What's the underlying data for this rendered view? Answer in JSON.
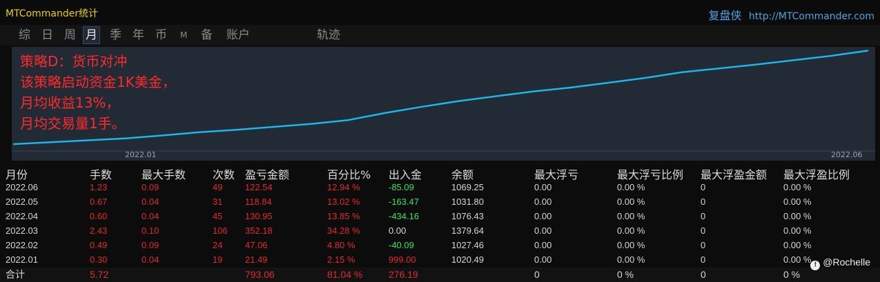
{
  "app_title": "MTCommander统计",
  "brand": {
    "name": "复盘侠",
    "url": "http://MTCommander.com"
  },
  "tabs": [
    {
      "label": "综"
    },
    {
      "label": "日"
    },
    {
      "label": "周"
    },
    {
      "label": "月",
      "active": true
    },
    {
      "label": "季"
    },
    {
      "label": "年"
    },
    {
      "label": "币"
    },
    {
      "label": "M"
    },
    {
      "label": "备"
    },
    {
      "label": "账户"
    },
    {
      "label": "轨迹"
    }
  ],
  "overlay": {
    "line1": "策略D：货币对冲",
    "line2": "该策略启动资金1K美金，",
    "line3": "月均收益13%，",
    "line4": "月均交易量1手。"
  },
  "colors": {
    "line": "#1eb4ec",
    "overlay_text": "#ff2a2a",
    "negative": "#e22a2a",
    "positive": "#2ee65a",
    "title": "#e8d100",
    "brand": "#4aa4e6"
  },
  "chart_data": {
    "type": "line",
    "x_ticks": [
      "2022.01",
      "2022.06"
    ],
    "series": [
      {
        "values": [
          1000,
          1004,
          1008,
          1012,
          1018,
          1025,
          1030,
          1036,
          1042,
          1050,
          1065,
          1078,
          1090,
          1100,
          1110,
          1118,
          1128,
          1138,
          1150,
          1158,
          1166,
          1175,
          1184,
          1195
        ]
      }
    ],
    "ylim": [
      990,
      1200
    ]
  },
  "table": {
    "headers": [
      "月份",
      "手数",
      "最大手数",
      "次数",
      "盈亏金额",
      "百分比%",
      "出入金",
      "余额",
      "最大浮亏",
      "最大浮亏比例",
      "最大浮盈金额",
      "最大浮盈比例"
    ],
    "rows": [
      [
        "2022.06",
        "1.23",
        "0.09",
        "49",
        "122.54",
        "12.94 %",
        "-85.09",
        "1069.25",
        "0.00",
        "0.00 %",
        "0",
        "0.00 %"
      ],
      [
        "2022.05",
        "0.67",
        "0.04",
        "31",
        "118.84",
        "13.02 %",
        "-163.47",
        "1031.80",
        "0.00",
        "0.00 %",
        "0",
        "0.00 %"
      ],
      [
        "2022.04",
        "0.60",
        "0.04",
        "45",
        "130.95",
        "13.85 %",
        "-434.16",
        "1076.43",
        "0.00",
        "0.00 %",
        "0",
        "0.00 %"
      ],
      [
        "2022.03",
        "2.43",
        "0.10",
        "106",
        "352.18",
        "34.28 %",
        "0.00",
        "1379.64",
        "0.00",
        "0.00 %",
        "0",
        "0.00 %"
      ],
      [
        "2022.02",
        "0.49",
        "0.09",
        "24",
        "47.06",
        "4.80 %",
        "-40.09",
        "1027.46",
        "0.00",
        "0.00 %",
        "0",
        "0.00 %"
      ],
      [
        "2022.01",
        "0.30",
        "0.04",
        "19",
        "21.49",
        "2.15 %",
        "999.00",
        "1020.49",
        "0.00",
        "0.00 %",
        "0",
        "0.00 %"
      ]
    ],
    "total": [
      "合计",
      "5.72",
      "",
      "",
      "793.06",
      "81.04 %",
      "276.19",
      "",
      "0",
      "0 %",
      "0",
      "0 %"
    ]
  },
  "watermark": "@Rochelle"
}
